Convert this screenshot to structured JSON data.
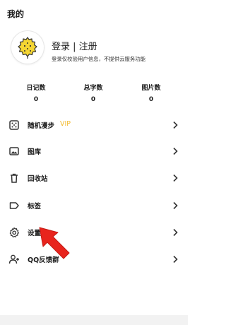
{
  "header": {
    "title": "我的"
  },
  "profile": {
    "avatar_icon": "durian-avatar-icon",
    "login_text": "登录 | 注册",
    "login_subtitle": "登录仅校验用户信息，不提供云服务功能"
  },
  "stats": [
    {
      "label": "日记数",
      "value": "0"
    },
    {
      "label": "总字数",
      "value": "0"
    },
    {
      "label": "图片数",
      "value": "0"
    }
  ],
  "menu": [
    {
      "label": "随机漫步",
      "badge": "VIP",
      "icon": "dice-icon"
    },
    {
      "label": "图库",
      "icon": "image-icon"
    },
    {
      "label": "回收站",
      "icon": "trash-icon"
    },
    {
      "label": "标签",
      "icon": "tag-icon"
    },
    {
      "label": "设置",
      "icon": "gear-icon"
    },
    {
      "label": "QQ反馈群",
      "icon": "add-user-icon"
    }
  ],
  "colors": {
    "vip": "#f2b92b",
    "arrow": "#e8241d",
    "avatar": "#f5d633"
  }
}
